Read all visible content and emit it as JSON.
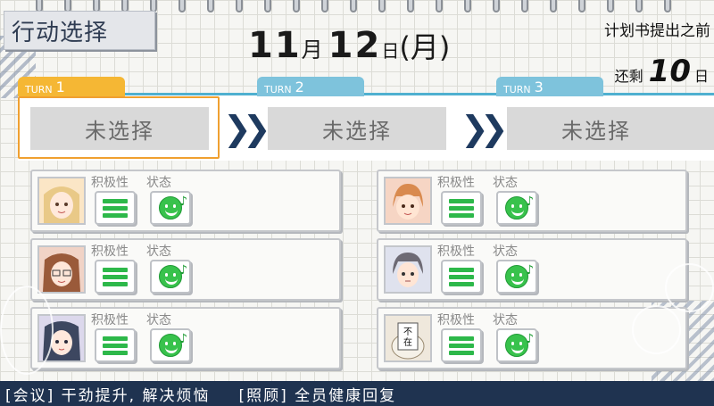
{
  "header": {
    "title": "行动选择",
    "date": {
      "month": "11",
      "month_unit": "月",
      "day": "12",
      "day_unit": "日",
      "paren_open": "(",
      "weekday": "月",
      "paren_close": ")"
    },
    "deadline_label": "计划书提出之前",
    "remaining_label": "还剩",
    "remaining_days": "10",
    "remaining_unit": "日"
  },
  "turns": [
    {
      "label": "TURN",
      "number": "1",
      "selection": "未选择",
      "active": true
    },
    {
      "label": "TURN",
      "number": "2",
      "selection": "未选择",
      "active": false
    },
    {
      "label": "TURN",
      "number": "3",
      "selection": "未选择",
      "active": false
    }
  ],
  "stat_labels": {
    "motivation": "积极性",
    "condition": "状态"
  },
  "members": [
    {
      "avatar": "blonde-girl-avatar",
      "motivation_level": 3,
      "condition": "happy"
    },
    {
      "avatar": "orange-hair-boy-avatar",
      "motivation_level": 3,
      "condition": "happy"
    },
    {
      "avatar": "brown-hair-girl-glasses-avatar",
      "motivation_level": 3,
      "condition": "happy"
    },
    {
      "avatar": "gray-hair-boy-avatar",
      "motivation_level": 3,
      "condition": "happy"
    },
    {
      "avatar": "dark-hair-girl-avatar",
      "motivation_level": 3,
      "condition": "happy"
    },
    {
      "avatar": "absent-sign-avatar",
      "avatar_text": "不在",
      "motivation_level": 3,
      "condition": "happy"
    }
  ],
  "footer": {
    "item1": "[会议] 干劲提升, 解决烦恼",
    "item2": "[照顾] 全员健康回复"
  },
  "colors": {
    "accent_orange": "#f5b734",
    "accent_blue": "#7ec3dc",
    "footer_bg": "#1f3350",
    "status_green": "#38c24c"
  }
}
